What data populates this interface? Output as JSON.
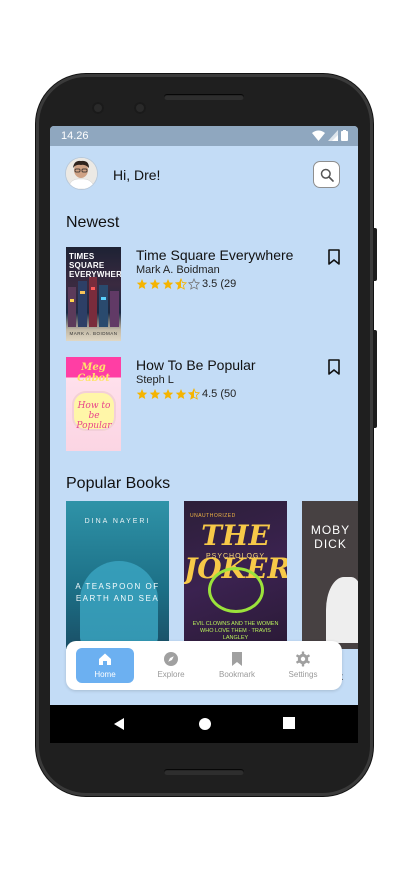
{
  "status_bar": {
    "time": "14.26"
  },
  "header": {
    "greeting": "Hi, Dre!",
    "avatar_icon": "user-avatar",
    "search_icon": "search-icon"
  },
  "sections": {
    "newest_title": "Newest",
    "popular_title": "Popular Books"
  },
  "newest_books": [
    {
      "title": "Time Square Everywhere",
      "author": "Mark A. Boidman",
      "rating": 3.5,
      "rating_text": "3.5 (29",
      "cover_title": "TIMES SQUARE EVERYWHERE",
      "cover_author": "MARK A. BOIDMAN"
    },
    {
      "title": "How To Be Popular",
      "author": "Steph L",
      "rating": 4.5,
      "rating_text": "4.5 (50",
      "cover_title": "Meg Cabot",
      "cover_inner": "How to be Popular"
    }
  ],
  "popular_books": [
    {
      "cover_author": "DINA NAYERI",
      "cover_title": "A TEASPOON OF EARTH AND SEA"
    },
    {
      "cover_brand": "UNAUTHORIZED",
      "cover_title": "THE JOKER",
      "cover_sub": "PSYCHOLOGY",
      "cover_footer": "EVIL CLOWNS AND THE WOMEN WHO LOVE THEM · TRAVIS LANGLEY"
    },
    {
      "cover_title": "MOBY DICK"
    }
  ],
  "behind_nav_text": {
    "third": "ck"
  },
  "bottom_nav": {
    "items": [
      {
        "label": "Home",
        "icon": "home-icon",
        "active": true
      },
      {
        "label": "Explore",
        "icon": "compass-icon",
        "active": false
      },
      {
        "label": "Bookmark",
        "icon": "bookmark-icon",
        "active": false
      },
      {
        "label": "Settings",
        "icon": "gear-icon",
        "active": false
      }
    ]
  },
  "colors": {
    "screen_bg": "#c3dcf6",
    "accent": "#6cb0f1",
    "star": "#f5b400",
    "status_bar": "#8fa7bf"
  }
}
